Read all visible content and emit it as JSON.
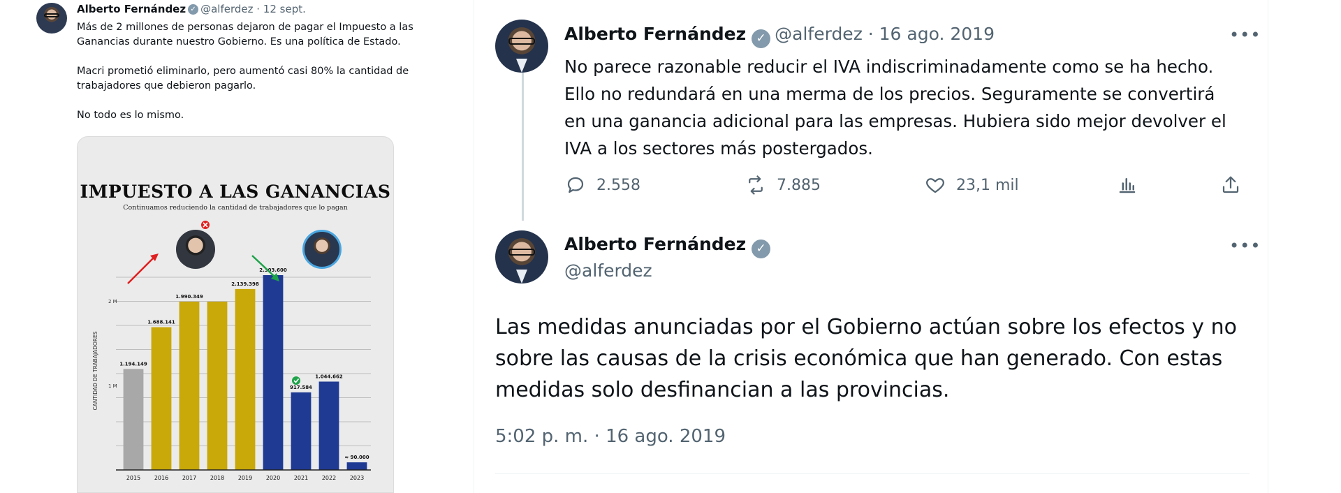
{
  "left_tweet": {
    "author_name": "Alberto Fernández",
    "handle_date": "@alferdez · 12 sept.",
    "paragraphs": [
      "Más de 2 millones de personas dejaron de pagar el Impuesto a las Ganancias durante nuestro Gobierno. Es una política de Estado.",
      "Macri prometió eliminarlo, pero aumentó casi 80% la cantidad de trabajadores que debieron pagarlo.",
      "No todo es lo mismo."
    ],
    "verified_mark": "✓"
  },
  "chart_data": {
    "type": "bar",
    "title": "IMPUESTO A LAS GANANCIAS",
    "subtitle": "Continuamos reduciendo la cantidad de trabajadores que lo pagan",
    "ylabel": "CANTIDAD DE TRABAJADORES",
    "ytick_labels": [
      "1 M",
      "2 M"
    ],
    "ylim": [
      0,
      2700000
    ],
    "categories": [
      "2015",
      "2016",
      "2017",
      "2018",
      "2019",
      "2020",
      "2021",
      "2022",
      "2023"
    ],
    "values": [
      1194149,
      1688141,
      1990349,
      1990349,
      2139398,
      2303600,
      917584,
      1044662,
      90000
    ],
    "data_labels": [
      "1.194.149",
      "1.688.141",
      "1.990.349",
      "",
      "2.139.398",
      "2.303.600",
      "917.584",
      "1.044.662",
      "≈ 90.000"
    ],
    "bar_colors": [
      "#a8a8a8",
      "#c9a80a",
      "#c9a80a",
      "#c9a80a",
      "#c9a80a",
      "#1f3a93",
      "#1f3a93",
      "#1f3a93",
      "#1f3a93"
    ],
    "grid": true
  },
  "thread": {
    "tweet1": {
      "author_name": "Alberto Fernández",
      "meta": "@alferdez · 16 ago. 2019",
      "text": "No parece razonable reducir el IVA indiscriminadamente como se ha hecho. Ello no redundará en una merma de los precios. Seguramente se convertirá en una ganancia adicional para las empresas. Hubiera sido mejor devolver el IVA a los sectores más postergados.",
      "more": "•••",
      "replies": "2.558",
      "retweets": "7.885",
      "likes": "23,1 mil"
    },
    "tweet2": {
      "author_name": "Alberto Fernández",
      "handle": "@alferdez",
      "more": "•••",
      "text": "Las medidas anunciadas por el Gobierno actúan sobre los efectos y no sobre las causas de la crisis económica que han generado. Con estas medidas solo desfinancian a las provincias.",
      "timestamp": "5:02 p. m. · 16 ago. 2019"
    },
    "verified_mark": "✓"
  },
  "colors": {
    "text_primary": "#0f1419",
    "text_secondary": "#536471",
    "verified_badge": "#829aab",
    "thread_line": "#cfd9de"
  }
}
